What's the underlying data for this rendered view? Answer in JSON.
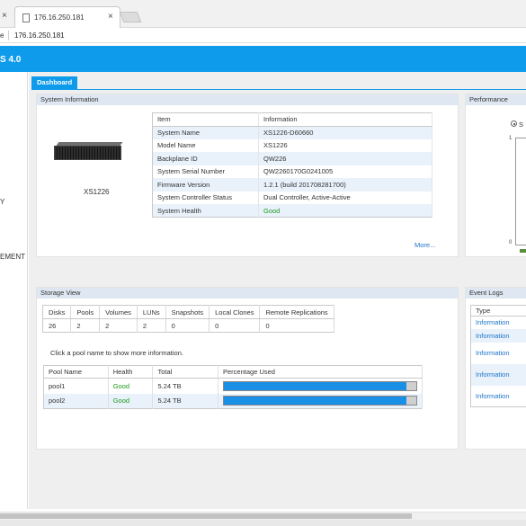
{
  "browser": {
    "prev_tab_close": "×",
    "active_tab_title": "176.16.250.181",
    "active_tab_close": "×",
    "address_prefix": "e",
    "address_url": "176.16.250.181"
  },
  "app": {
    "title": "S 4.0",
    "nav_items": [
      "Y",
      "EMENT"
    ]
  },
  "dashboard": {
    "tab_label": "Dashboard"
  },
  "system_information": {
    "title": "System Information",
    "device_name": "XS1226",
    "table_headers": [
      "Item",
      "Information"
    ],
    "rows": [
      {
        "item": "System Name",
        "value": "XS1226-D60660"
      },
      {
        "item": "Model Name",
        "value": "XS1226"
      },
      {
        "item": "Backplane ID",
        "value": "QW226"
      },
      {
        "item": "System Serial Number",
        "value": "QW2260170G0241005"
      },
      {
        "item": "Firmware Version",
        "value": "1.2.1 (build 201708281700)"
      },
      {
        "item": "System Controller Status",
        "value": "Dual Controller, Active-Active"
      },
      {
        "item": "System Health",
        "value": "Good"
      }
    ],
    "more_link": "More..."
  },
  "performance": {
    "title": "Performance",
    "radio_label": "S",
    "axis_top": "1",
    "axis_bottom": "0"
  },
  "storage_view": {
    "title": "Storage View",
    "stats_headers": [
      "Disks",
      "Pools",
      "Volumes",
      "LUNs",
      "Snapshots",
      "Local Clones",
      "Remote Replications"
    ],
    "stats_values": [
      "26",
      "2",
      "2",
      "2",
      "0",
      "0",
      "0"
    ],
    "hint": "Click a pool name to show more information.",
    "pool_headers": [
      "Pool Name",
      "Health",
      "Total",
      "Percentage Used"
    ],
    "pools": [
      {
        "name": "pool1",
        "health": "Good",
        "total": "5.24 TB",
        "used_fraction": 0.95
      },
      {
        "name": "pool2",
        "health": "Good",
        "total": "5.24 TB",
        "used_fraction": 0.95
      }
    ]
  },
  "event_logs": {
    "title": "Event Logs",
    "header": "Type",
    "entries": [
      "Information",
      "Information",
      "Information",
      "Information",
      "Information"
    ]
  },
  "colors": {
    "accent": "#0f9bec",
    "good": "#1c9a1c",
    "link": "#1c73c9",
    "bar_fill": "#1a8fe6"
  }
}
